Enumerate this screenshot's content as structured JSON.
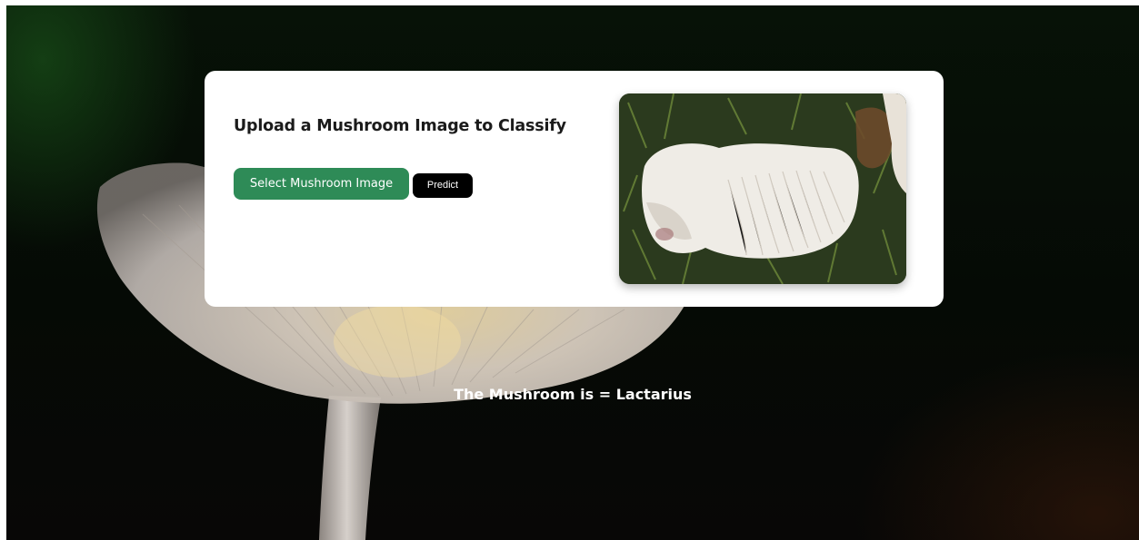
{
  "upload_card": {
    "title": "Upload a Mushroom Image to Classify",
    "select_button_label": "Select Mushroom Image",
    "predict_button_label": "Predict"
  },
  "preview": {
    "image": "uploaded-mushroom-photo"
  },
  "result": {
    "text": "The Mushroom is = Lactarius"
  },
  "colors": {
    "select_button": "#2e8b57",
    "predict_button": "#000000",
    "card_background": "#ffffff",
    "page_background": "#071207",
    "result_text": "#ffffff"
  }
}
